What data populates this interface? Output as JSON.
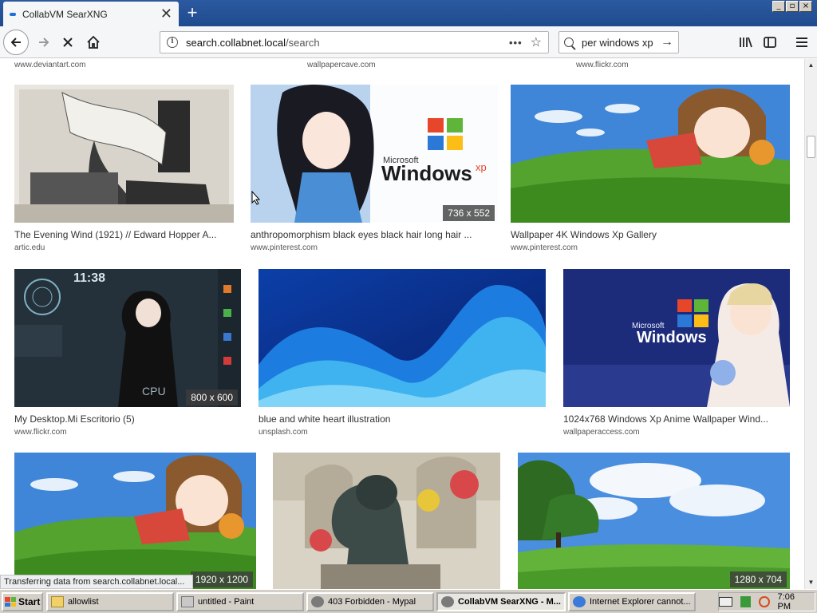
{
  "browser": {
    "tab_title": "CollabVM SearXNG",
    "new_tab": "+",
    "window_controls": [
      "_",
      "▫",
      "×"
    ],
    "url_host": "search.collabnet.local",
    "url_path": "/search",
    "search_query": "per windows xp",
    "status_text": "Transferring data from search.collabnet.local..."
  },
  "top_sources": [
    "www.deviantart.com",
    "wallpapercave.com",
    "www.flickr.com"
  ],
  "results": [
    {
      "caption": "The Evening Wind (1921) // Edward Hopper A...",
      "domain": "artic.edu",
      "resolution": ""
    },
    {
      "caption": "anthropomorphism black eyes black hair long hair ...",
      "domain": "www.pinterest.com",
      "resolution": "736 x 552"
    },
    {
      "caption": "Wallpaper 4K Windows Xp Gallery",
      "domain": "www.pinterest.com",
      "resolution": ""
    },
    {
      "caption": "My Desktop.Mi Escritorio (5)",
      "domain": "www.flickr.com",
      "resolution": "800 x 600"
    },
    {
      "caption": "blue and white heart illustration",
      "domain": "unsplash.com",
      "resolution": ""
    },
    {
      "caption": "1024x768 Windows Xp Anime Wallpaper Wind...",
      "domain": "wallpaperaccess.com",
      "resolution": ""
    },
    {
      "caption": "",
      "domain": "",
      "resolution": "1920 x 1200"
    },
    {
      "caption": "",
      "domain": "",
      "resolution": ""
    },
    {
      "caption": "",
      "domain": "",
      "resolution": "1280 x 704"
    }
  ],
  "image_text": {
    "windows_logo_1": "Windows",
    "windows_xp_sub": "xp",
    "microsoft_1": "Microsoft",
    "windows_logo_2": "Windows",
    "microsoft_2": "Microsoft",
    "desktop_clock": "11:38",
    "desktop_cpu": "CPU"
  },
  "taskbar": {
    "start": "Start",
    "tasks": [
      "allowlist",
      "untitled - Paint",
      "403 Forbidden - Mypal",
      "CollabVM SearXNG - M...",
      "Internet Explorer cannot..."
    ],
    "clock": "7:06 PM"
  }
}
